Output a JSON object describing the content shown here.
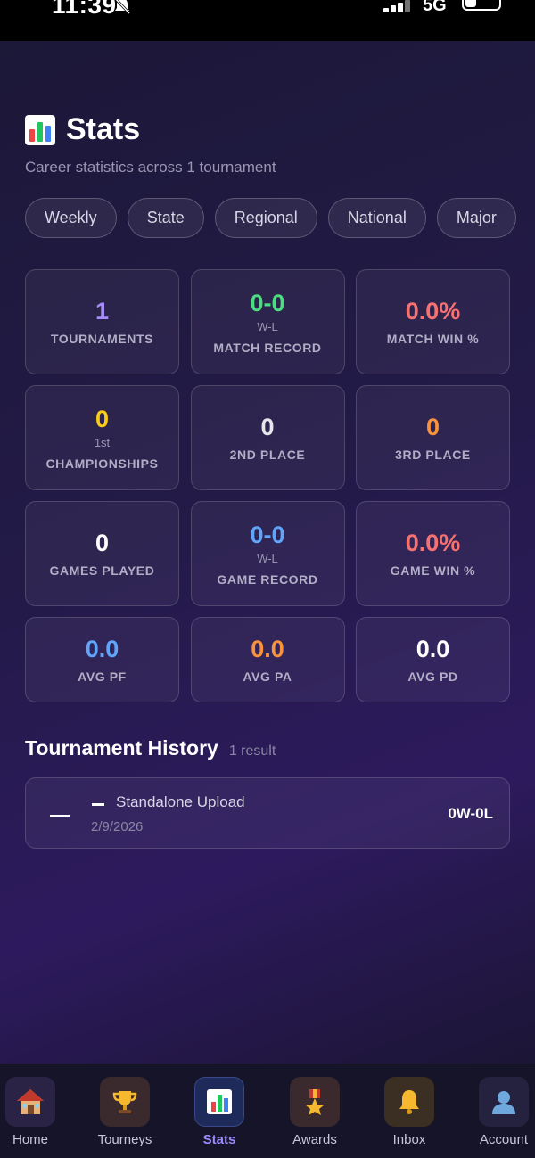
{
  "status_bar": {
    "time": "11:39",
    "network": "5G",
    "bell_icon": "bell-slash-icon"
  },
  "page": {
    "title": "Stats",
    "title_icon": "bar-chart-icon",
    "subtitle": "Career statistics across 1 tournament"
  },
  "filters": [
    "Weekly",
    "State",
    "Regional",
    "National",
    "Major"
  ],
  "stats": [
    {
      "value": "1",
      "sub": "",
      "label": "TOURNAMENTS",
      "color": "#a78bfa"
    },
    {
      "value": "0-0",
      "sub": "W-L",
      "label": "MATCH RECORD",
      "color": "#4ade80"
    },
    {
      "value": "0.0%",
      "sub": "",
      "label": "MATCH WIN %",
      "color": "#f87171"
    },
    {
      "value": "0",
      "sub": "1st",
      "label": "CHAMPIONSHIPS",
      "color": "#facc15"
    },
    {
      "value": "0",
      "sub": "",
      "label": "2ND PLACE",
      "color": "#e5e7eb"
    },
    {
      "value": "0",
      "sub": "",
      "label": "3RD PLACE",
      "color": "#fb923c"
    },
    {
      "value": "0",
      "sub": "",
      "label": "GAMES PLAYED",
      "color": "#ffffff"
    },
    {
      "value": "0-0",
      "sub": "W-L",
      "label": "GAME RECORD",
      "color": "#60a5fa"
    },
    {
      "value": "0.0%",
      "sub": "",
      "label": "GAME WIN %",
      "color": "#f87171"
    },
    {
      "value": "0.0",
      "sub": "",
      "label": "AVG PF",
      "color": "#60a5fa"
    },
    {
      "value": "0.0",
      "sub": "",
      "label": "AVG PA",
      "color": "#fb923c"
    },
    {
      "value": "0.0",
      "sub": "",
      "label": "AVG PD",
      "color": "#ffffff"
    }
  ],
  "history": {
    "title": "Tournament History",
    "count": "1 result",
    "items": [
      {
        "name": "Standalone Upload",
        "date": "2/9/2026",
        "record": "0W-0L"
      }
    ]
  },
  "tabbar": {
    "items": [
      {
        "label": "Home",
        "icon": "house-icon"
      },
      {
        "label": "Tourneys",
        "icon": "trophy-icon"
      },
      {
        "label": "Stats",
        "icon": "bar-chart-icon"
      },
      {
        "label": "Awards",
        "icon": "medal-icon"
      },
      {
        "label": "Inbox",
        "icon": "bell-icon"
      },
      {
        "label": "Account",
        "icon": "user-icon"
      }
    ]
  }
}
